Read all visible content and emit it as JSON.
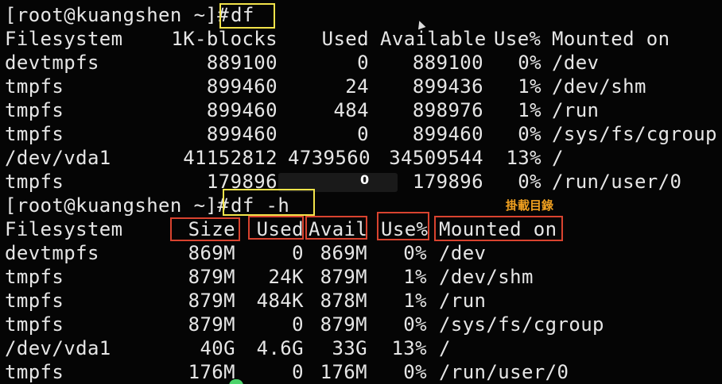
{
  "terminal": {
    "prompt1": "[root@kuangshen ~]#",
    "cmd1": "df",
    "prompt2": "[root@kuangshen ~]#",
    "cmd2": "df -h"
  },
  "df_table": {
    "headers": [
      "Filesystem",
      "1K-blocks",
      "Used",
      "Available",
      "Use%",
      "Mounted on"
    ],
    "rows": [
      [
        "devtmpfs",
        "889100",
        "0",
        "889100",
        "0%",
        "/dev"
      ],
      [
        "tmpfs",
        "899460",
        "24",
        "899436",
        "1%",
        "/dev/shm"
      ],
      [
        "tmpfs",
        "899460",
        "484",
        "898976",
        "1%",
        "/run"
      ],
      [
        "tmpfs",
        "899460",
        "0",
        "899460",
        "0%",
        "/sys/fs/cgroup"
      ],
      [
        "/dev/vda1",
        "41152812",
        "4739560",
        "34509544",
        "13%",
        "/"
      ],
      [
        "tmpfs",
        "179896",
        "",
        "179896",
        "0%",
        "/run/user/0"
      ]
    ]
  },
  "dfh_table": {
    "headers": [
      "Filesystem",
      "Size",
      "Used",
      "Avail",
      "Use%",
      "Mounted on"
    ],
    "rows": [
      [
        "devtmpfs",
        "869M",
        "0",
        "869M",
        "0%",
        "/dev"
      ],
      [
        "tmpfs",
        "879M",
        "24K",
        "879M",
        "1%",
        "/dev/shm"
      ],
      [
        "tmpfs",
        "879M",
        "484K",
        "878M",
        "1%",
        "/run"
      ],
      [
        "tmpfs",
        "879M",
        "0",
        "879M",
        "0%",
        "/sys/fs/cgroup"
      ],
      [
        "/dev/vda1",
        "40G",
        "4.6G",
        "33G",
        "13%",
        "/"
      ],
      [
        "tmpfs",
        "176M",
        "0",
        "176M",
        "0%",
        "/run/user/0"
      ]
    ]
  },
  "annotations": {
    "overlay_zero": "0",
    "mount_note": "掛載目錄"
  },
  "colors": {
    "terminal_bg": "#050505",
    "text": "#e6e6e6",
    "highlight_yellow": "#f2e34a",
    "highlight_red": "#d9432f",
    "note_orange": "#f0a020"
  }
}
